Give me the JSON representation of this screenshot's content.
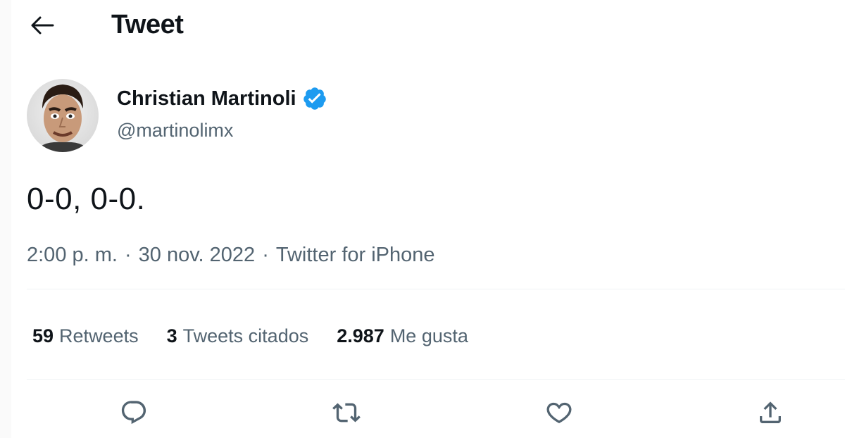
{
  "header": {
    "title": "Tweet",
    "back_icon": "arrow-left-icon"
  },
  "author": {
    "display_name": "Christian Martinoli",
    "handle": "@martinolimx",
    "verified": true,
    "verified_color": "#1d9bf0"
  },
  "tweet": {
    "text": "0-0, 0-0.",
    "time": "2:00 p. m.",
    "sep1": "·",
    "date": "30 nov. 2022",
    "sep2": "·",
    "source": "Twitter for iPhone"
  },
  "stats": [
    {
      "count": "59",
      "label": "Retweets"
    },
    {
      "count": "3",
      "label": "Tweets citados"
    },
    {
      "count": "2.987",
      "label": "Me gusta"
    }
  ],
  "actions": [
    "reply-icon",
    "retweet-icon",
    "like-icon",
    "share-icon"
  ],
  "colors": {
    "text": "#0f1419",
    "secondary": "#536471",
    "divider": "#eff3f4"
  }
}
